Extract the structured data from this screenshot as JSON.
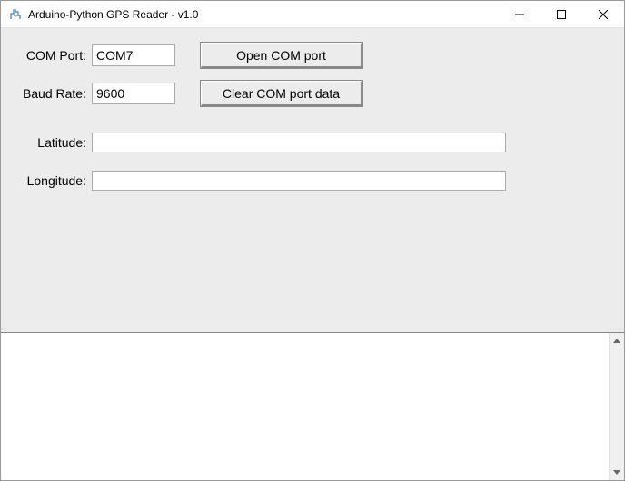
{
  "window": {
    "title": "Arduino-Python GPS Reader - v1.0"
  },
  "form": {
    "comport_label": "COM Port:",
    "comport_value": "COM7",
    "baud_label": "Baud Rate:",
    "baud_value": "9600",
    "latitude_label": "Latitude:",
    "latitude_value": "",
    "longitude_label": "Longitude:",
    "longitude_value": ""
  },
  "buttons": {
    "open_port": "Open COM port",
    "clear_data": "Clear COM port data"
  },
  "output": {
    "text": ""
  }
}
